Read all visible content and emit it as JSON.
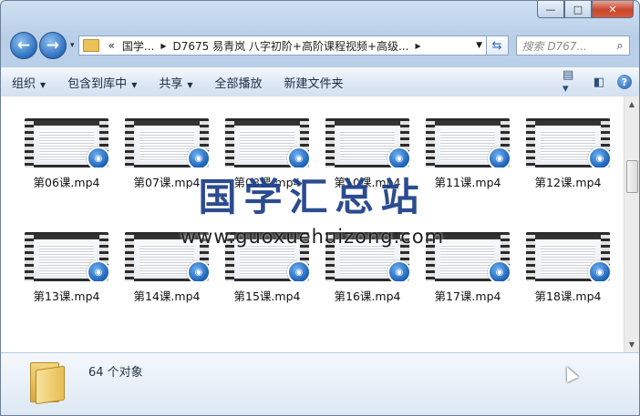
{
  "window": {
    "controls": {
      "minimize": "—",
      "maximize": "□",
      "close": "✕"
    }
  },
  "nav": {
    "back_icon": "back-arrow-icon",
    "forward_icon": "forward-arrow-icon",
    "history_dropdown": "▾",
    "address": {
      "overflow": "«",
      "crumbs": [
        "国学...",
        "D7675 易青岚 八字初阶+高阶课程视频+高级..."
      ]
    },
    "refresh_icon": "refresh-icon",
    "search_placeholder": "搜索 D767..."
  },
  "toolbar": {
    "organize": "组织",
    "include_in_library": "包含到库中",
    "share": "共享",
    "play_all": "全部播放",
    "new_folder": "新建文件夹"
  },
  "files": [
    {
      "name": "第06课.mp4"
    },
    {
      "name": "第07课.mp4"
    },
    {
      "name": "第08课.mp4"
    },
    {
      "name": "第10课.mp4"
    },
    {
      "name": "第11课.mp4"
    },
    {
      "name": "第12课.mp4"
    },
    {
      "name": "第13课.mp4"
    },
    {
      "name": "第14课.mp4"
    },
    {
      "name": "第15课.mp4"
    },
    {
      "name": "第16课.mp4"
    },
    {
      "name": "第17课.mp4"
    },
    {
      "name": "第18课.mp4"
    }
  ],
  "watermark": {
    "title": "国学汇总站",
    "url": "www.guoxuehuizong.com"
  },
  "details": {
    "count": "64 个对象"
  }
}
